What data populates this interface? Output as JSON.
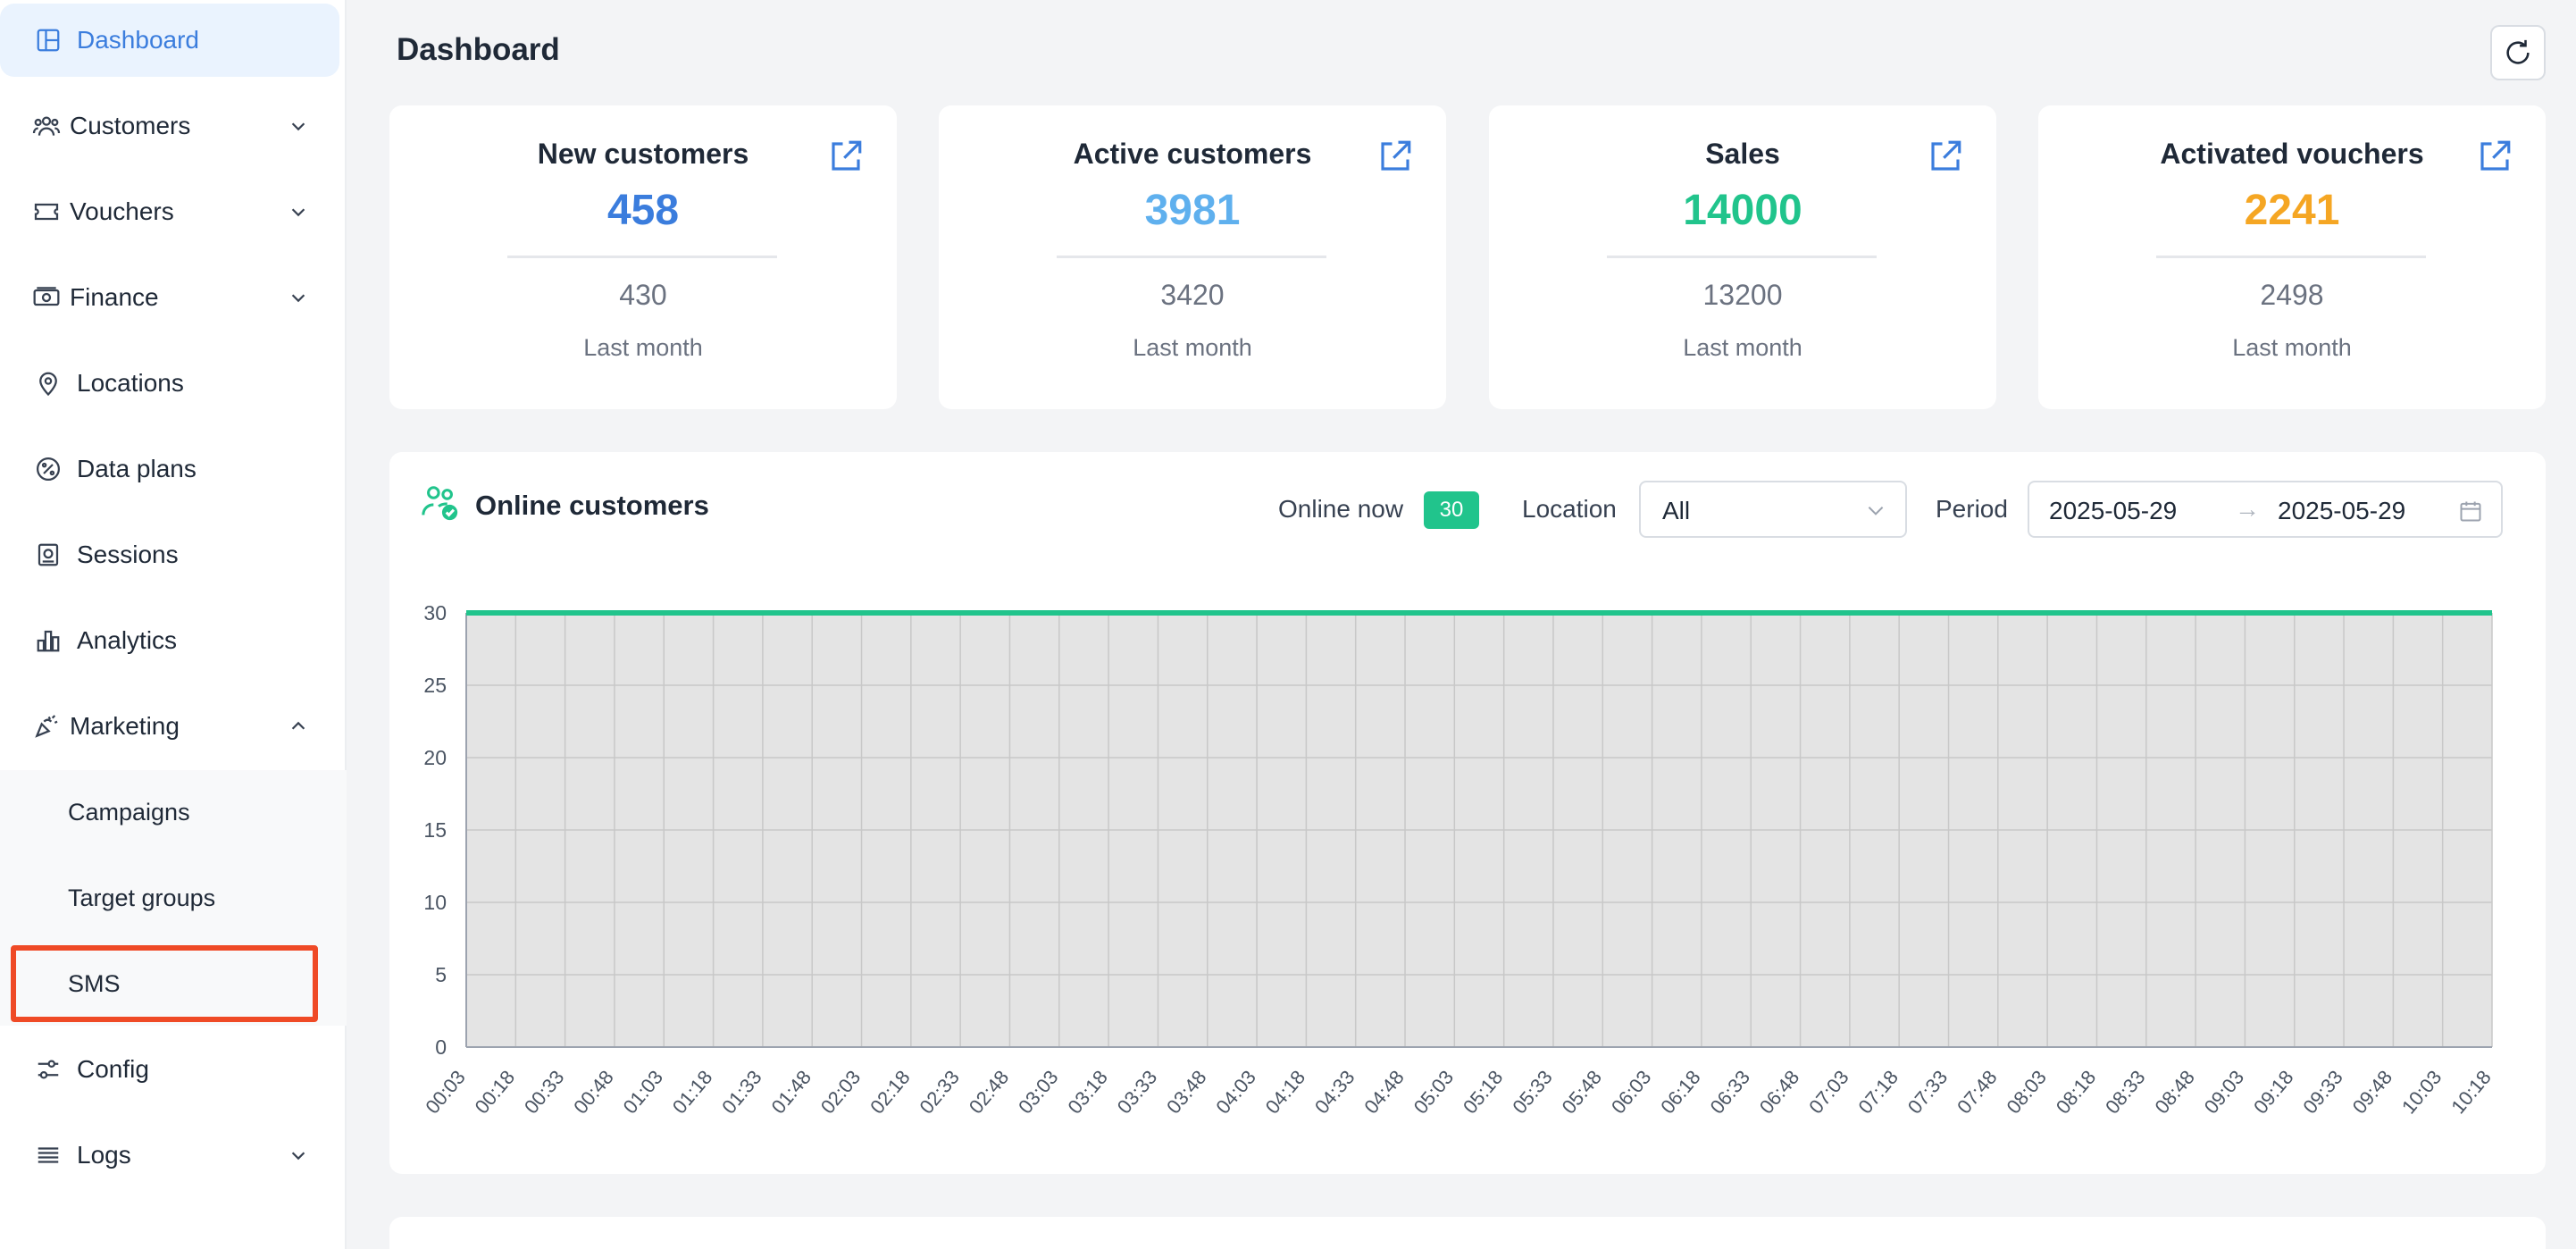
{
  "sidebar": {
    "items": [
      {
        "label": "Dashboard"
      },
      {
        "label": "Customers"
      },
      {
        "label": "Vouchers"
      },
      {
        "label": "Finance"
      },
      {
        "label": "Locations"
      },
      {
        "label": "Data plans"
      },
      {
        "label": "Sessions"
      },
      {
        "label": "Analytics"
      },
      {
        "label": "Marketing"
      },
      {
        "label": "Config"
      },
      {
        "label": "Logs"
      }
    ],
    "marketing_sub": [
      {
        "label": "Campaigns"
      },
      {
        "label": "Target groups"
      },
      {
        "label": "SMS"
      }
    ],
    "accent": "#3b7ddd",
    "highlight_color": "#ef4a26"
  },
  "header": {
    "title": "Dashboard"
  },
  "stats": [
    {
      "title": "New customers",
      "value": "458",
      "prev": "430",
      "sub": "Last month",
      "color": "#3b7ddd"
    },
    {
      "title": "Active customers",
      "value": "3981",
      "prev": "3420",
      "sub": "Last month",
      "color": "#5fb0ee"
    },
    {
      "title": "Sales",
      "value": "14000",
      "prev": "13200",
      "sub": "Last month",
      "color": "#21c48c"
    },
    {
      "title": "Activated vouchers",
      "value": "2241",
      "prev": "2498",
      "sub": "Last month",
      "color": "#f5a623"
    }
  ],
  "online": {
    "title": "Online customers",
    "online_now_label": "Online now",
    "online_now_value": "30",
    "location_label": "Location",
    "location_value": "All",
    "period_label": "Period",
    "date_from": "2025-05-29",
    "date_arrow": "→",
    "date_to": "2025-05-29"
  },
  "chart_data": {
    "type": "area",
    "title": "",
    "xlabel": "",
    "ylabel": "",
    "ylim": [
      0,
      30
    ],
    "yticks": [
      0,
      5,
      10,
      15,
      20,
      25,
      30
    ],
    "x": [
      "00:03",
      "00:18",
      "00:33",
      "00:48",
      "01:03",
      "01:18",
      "01:33",
      "01:48",
      "02:03",
      "02:18",
      "02:33",
      "02:48",
      "03:03",
      "03:18",
      "03:33",
      "03:48",
      "04:03",
      "04:18",
      "04:33",
      "04:48",
      "05:03",
      "05:18",
      "05:33",
      "05:48",
      "06:03",
      "06:18",
      "06:33",
      "06:48",
      "07:03",
      "07:18",
      "07:33",
      "07:48",
      "08:03",
      "08:18",
      "08:33",
      "08:48",
      "09:03",
      "09:18",
      "09:33",
      "09:48",
      "10:03",
      "10:18"
    ],
    "series": [
      {
        "values": [
          30,
          30,
          30,
          30,
          30,
          30,
          30,
          30,
          30,
          30,
          30,
          30,
          30,
          30,
          30,
          30,
          30,
          30,
          30,
          30,
          30,
          30,
          30,
          30,
          30,
          30,
          30,
          30,
          30,
          30,
          30,
          30,
          30,
          30,
          30,
          30,
          30,
          30,
          30,
          30,
          30,
          30
        ]
      }
    ],
    "grid": true,
    "line_color": "#21c48c",
    "fill_color": "#e4e4e4"
  }
}
